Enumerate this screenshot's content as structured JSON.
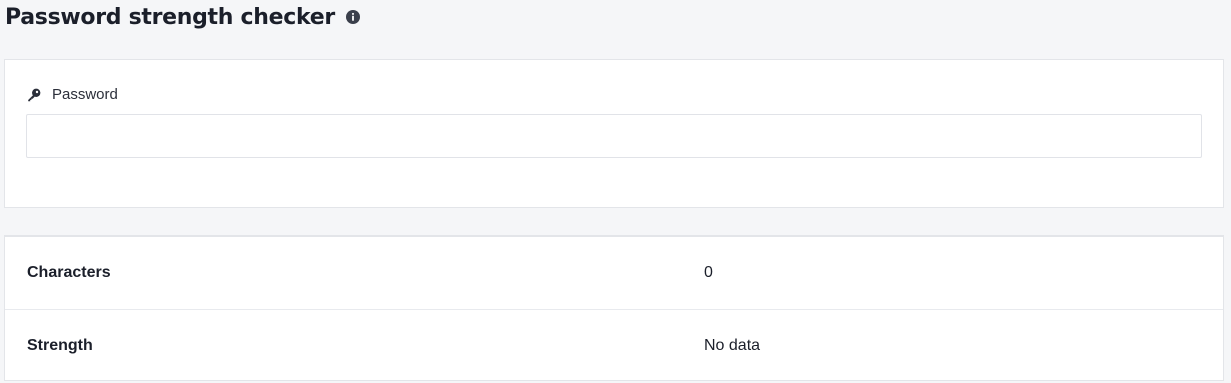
{
  "header": {
    "title": "Password strength checker",
    "info_icon": "info-circle-icon"
  },
  "input_section": {
    "label": "Password",
    "label_icon": "key-icon",
    "value": "",
    "placeholder": ""
  },
  "results": {
    "rows": [
      {
        "label": "Characters",
        "value": "0"
      },
      {
        "label": "Strength",
        "value": "No data"
      }
    ]
  },
  "colors": {
    "background": "#f5f6f8",
    "card": "#ffffff",
    "border": "#e3e5e9",
    "text": "#1b1f2a"
  }
}
